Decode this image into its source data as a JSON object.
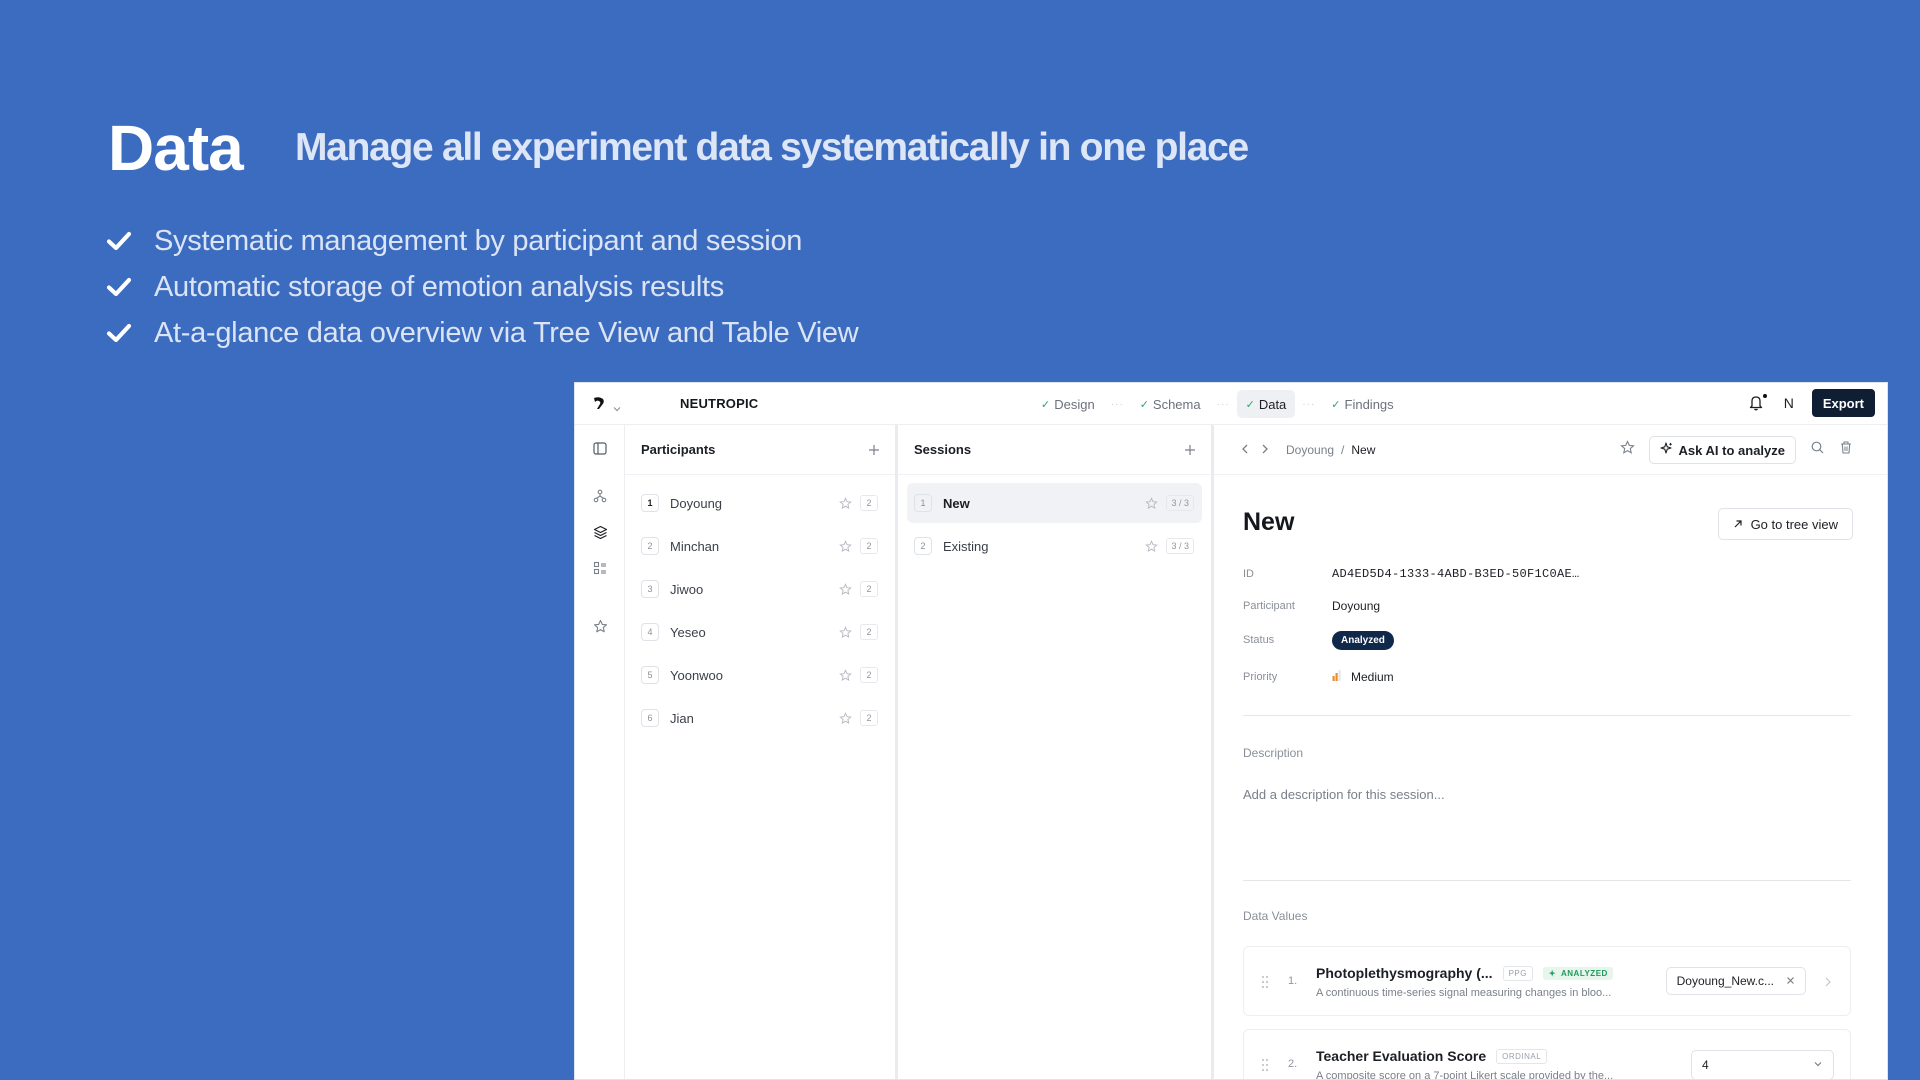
{
  "hero": {
    "title": "Data",
    "subtitle": "Manage all experiment data systematically in one place",
    "bullets": [
      "Systematic management by participant and session",
      "Automatic storage of emotion analysis results",
      "At-a-glance data overview via Tree View and Table View"
    ]
  },
  "app": {
    "brand": "NEUTROPIC",
    "steps": [
      {
        "label": "Design",
        "done": true
      },
      {
        "label": "Schema",
        "done": true
      },
      {
        "label": "Data",
        "done": true,
        "active": true
      },
      {
        "label": "Findings",
        "done": true
      }
    ],
    "avatar_initial": "N",
    "export_label": "Export"
  },
  "participants": {
    "header": "Participants",
    "items": [
      {
        "index": "1",
        "name": "Doyoung",
        "count": "2"
      },
      {
        "index": "2",
        "name": "Minchan",
        "count": "2"
      },
      {
        "index": "3",
        "name": "Jiwoo",
        "count": "2"
      },
      {
        "index": "4",
        "name": "Yeseo",
        "count": "2"
      },
      {
        "index": "5",
        "name": "Yoonwoo",
        "count": "2"
      },
      {
        "index": "6",
        "name": "Jian",
        "count": "2"
      }
    ]
  },
  "sessions": {
    "header": "Sessions",
    "items": [
      {
        "index": "1",
        "name": "New",
        "count": "3 / 3",
        "selected": true
      },
      {
        "index": "2",
        "name": "Existing",
        "count": "3 / 3"
      }
    ]
  },
  "detail": {
    "breadcrumb": [
      "Doyoung",
      "/",
      "New"
    ],
    "ask_ai_label": "Ask AI to analyze",
    "title": "New",
    "tree_view_label": "Go to tree view",
    "props": {
      "id_label": "ID",
      "id_value": "AD4ED5D4-1333-4ABD-B3ED-50F1C0AE…",
      "participant_label": "Participant",
      "participant_value": "Doyoung",
      "status_label": "Status",
      "status_value": "Analyzed",
      "priority_label": "Priority",
      "priority_value": "Medium"
    },
    "description_label": "Description",
    "description_placeholder": "Add a description for this session...",
    "data_values_label": "Data Values",
    "values": [
      {
        "index": "1.",
        "name": "Photoplethysmography (...",
        "tag": "PPG",
        "status_tag": "ANALYZED",
        "subtitle": "A continuous time-series signal measuring changes in bloo...",
        "file": "Doyoung_New.c..."
      },
      {
        "index": "2.",
        "name": "Teacher Evaluation Score",
        "tag": "ORDINAL",
        "subtitle": "A composite score on a 7-point Likert scale provided by the...",
        "selected_value": "4"
      }
    ]
  },
  "colors": {
    "background": "#3c6cc0",
    "export_button": "#0f1e33",
    "analyzed_badge": "#10284a",
    "check_green": "#2ca66b",
    "priority_orange": "#f08c28"
  }
}
